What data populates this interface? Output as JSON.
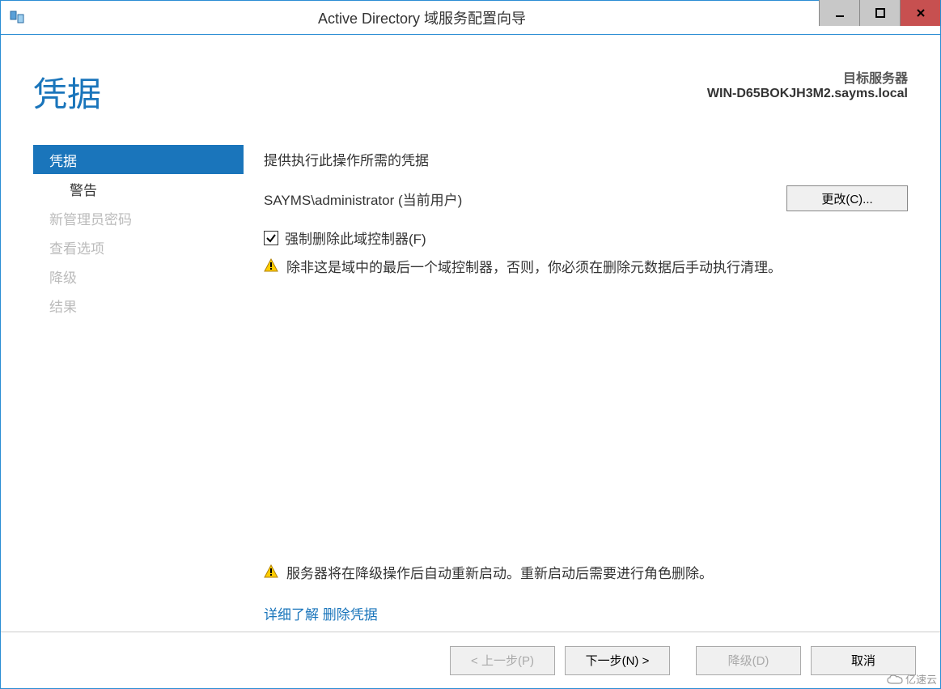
{
  "window": {
    "title": "Active Directory 域服务配置向导"
  },
  "header": {
    "page_title": "凭据",
    "target_label": "目标服务器",
    "target_server": "WIN-D65BOKJH3M2.sayms.local"
  },
  "sidebar": {
    "items": [
      {
        "label": "凭据",
        "state": "active"
      },
      {
        "label": "警告",
        "state": "sub"
      },
      {
        "label": "新管理员密码",
        "state": "disabled"
      },
      {
        "label": "查看选项",
        "state": "disabled"
      },
      {
        "label": "降级",
        "state": "disabled"
      },
      {
        "label": "结果",
        "state": "disabled"
      }
    ]
  },
  "content": {
    "instruction": "提供执行此操作所需的凭据",
    "current_user": "SAYMS\\administrator (当前用户)",
    "change_button": "更改(C)...",
    "force_remove_checkbox": {
      "checked": true,
      "label": "强制删除此域控制器(F)"
    },
    "warning1": "除非这是域中的最后一个域控制器，否则，你必须在删除元数据后手动执行清理。",
    "warning2": "服务器将在降级操作后自动重新启动。重新启动后需要进行角色删除。",
    "link": "详细了解 删除凭据"
  },
  "footer": {
    "back": "< 上一步(P)",
    "next": "下一步(N) >",
    "demote": "降级(D)",
    "cancel": "取消"
  },
  "watermark": "亿速云"
}
